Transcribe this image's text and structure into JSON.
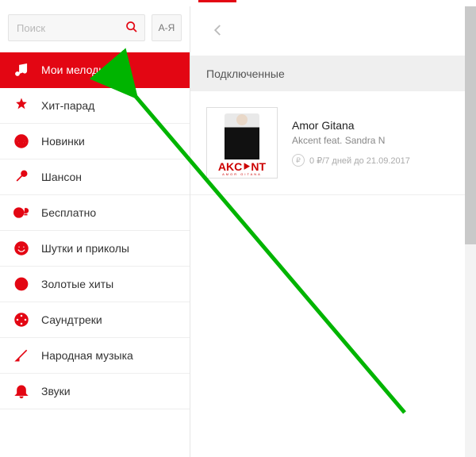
{
  "search": {
    "placeholder": "Поиск"
  },
  "az_button": "А-Я",
  "sidebar": {
    "items": [
      {
        "label": "Мои мелодии"
      },
      {
        "label": "Хит-парад"
      },
      {
        "label": "Новинки"
      },
      {
        "label": "Шансон"
      },
      {
        "label": "Бесплатно"
      },
      {
        "label": "Шутки и приколы"
      },
      {
        "label": "Золотые хиты"
      },
      {
        "label": "Саундтреки"
      },
      {
        "label": "Народная музыка"
      },
      {
        "label": "Звуки"
      }
    ]
  },
  "section_header": "Подключенные",
  "track": {
    "title": "Amor Gitana",
    "artist": "Akcent feat. Sandra N",
    "price_label": "0 ₽/7 дней до 21.09.2017",
    "cover_logo": "AKC⯈NT",
    "cover_sub": "AMOR GITANA"
  },
  "colors": {
    "accent": "#e30613"
  }
}
